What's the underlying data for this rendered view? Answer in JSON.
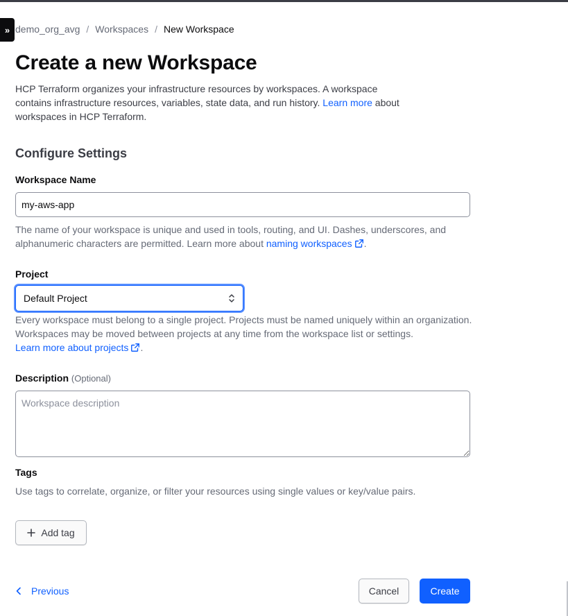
{
  "breadcrumb": {
    "org": "demo_org_avg",
    "separator": "/",
    "workspaces": "Workspaces",
    "current": "New Workspace"
  },
  "page": {
    "title": "Create a new Workspace",
    "intro_before": "HCP Terraform organizes your infrastructure resources by workspaces. A workspace contains infrastructure resources, variables, state data, and run history. ",
    "intro_link": "Learn more",
    "intro_after": " about workspaces in HCP Terraform."
  },
  "settings": {
    "section_title": "Configure Settings",
    "workspace_name": {
      "label": "Workspace Name",
      "value": "my-aws-app",
      "help_before": "The name of your workspace is unique and used in tools, routing, and UI. Dashes, underscores, and alphanumeric characters are permitted. Learn more about ",
      "help_link": "naming workspaces",
      "help_after": "."
    },
    "project": {
      "label": "Project",
      "selected": "Default Project",
      "help": "Every workspace must belong to a single project. Projects must be named uniquely within an organization. Workspaces may be moved between projects at any time from the workspace list or settings.",
      "help_link": "Learn more about projects",
      "help_after": "."
    },
    "description": {
      "label": "Description",
      "optional": "(Optional)",
      "placeholder": "Workspace description"
    },
    "tags": {
      "label": "Tags",
      "help": "Use tags to correlate, organize, or filter your resources using single values or key/value pairs.",
      "add_label": "Add tag"
    }
  },
  "footer": {
    "previous": "Previous",
    "cancel": "Cancel",
    "create": "Create"
  },
  "icons": {
    "sidebar_toggle": "chevrons-right-icon",
    "external_link": "external-link-icon",
    "select_arrows": "chevron-up-down-icon",
    "add": "plus-icon",
    "previous": "chevron-left-icon"
  },
  "colors": {
    "accent": "#1060ff",
    "text": "#3b3d45",
    "muted": "#656a76"
  }
}
